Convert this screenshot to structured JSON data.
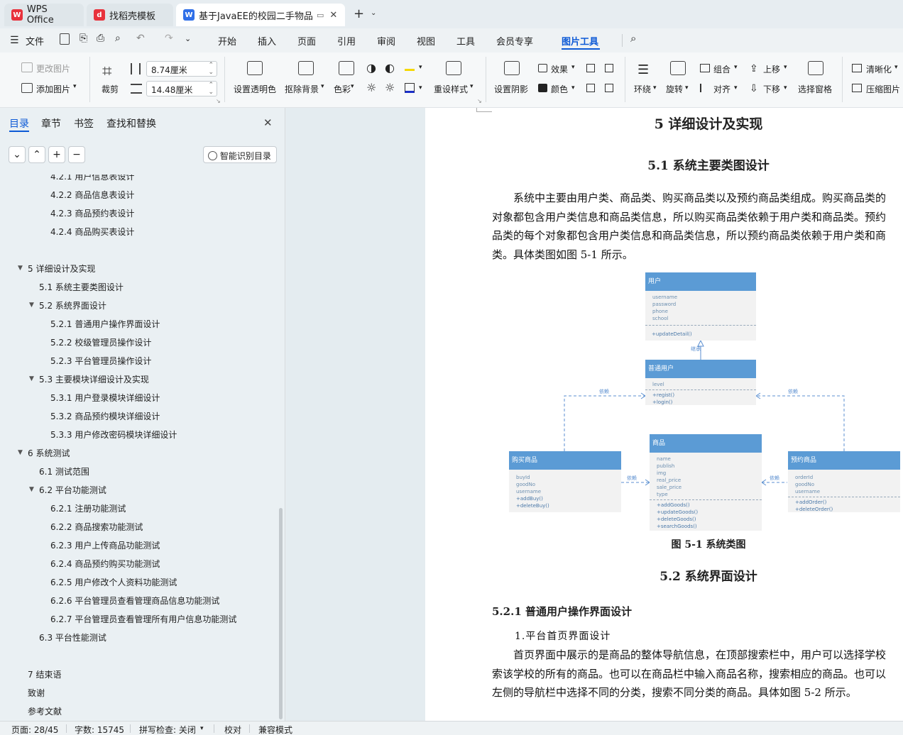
{
  "tabs": [
    {
      "label": "WPS Office"
    },
    {
      "label": "找稻壳模板"
    },
    {
      "label": "基于JavaEE的校园二手物品交"
    }
  ],
  "menu": {
    "file": "文件",
    "items": [
      "开始",
      "插入",
      "页面",
      "引用",
      "审阅",
      "视图",
      "工具",
      "会员专享",
      "图片工具"
    ]
  },
  "ribbon": {
    "change_pic": "更改图片",
    "add_pic": "添加图片",
    "crop": "裁剪",
    "width_value": "8.74厘米",
    "height_value": "14.48厘米",
    "transparent": "设置透明色",
    "remove_bg": "抠除背景",
    "color": "色彩",
    "reset_style": "重设样式",
    "shadow": "设置阴影",
    "effect": "效果",
    "fill_color": "颜色",
    "wrap": "环绕",
    "rotate": "旋转",
    "group": "组合",
    "align": "对齐",
    "up": "上移",
    "down": "下移",
    "select_pane": "选择窗格",
    "sharpen": "清晰化",
    "compress": "压缩图片"
  },
  "nav": {
    "tabs": [
      "目录",
      "章节",
      "书签",
      "查找和替换"
    ],
    "smart_btn": "智能识别目录",
    "items": [
      {
        "label": "4.2.1  用户信息表设计",
        "level": 3
      },
      {
        "label": "4.2.2  商品信息表设计",
        "level": 3
      },
      {
        "label": "4.2.3  商品预约表设计",
        "level": 3
      },
      {
        "label": "4.2.4  商品购买表设计",
        "level": 3
      },
      {
        "label": "5  详细设计及实现",
        "level": 1
      },
      {
        "label": "5.1  系统主要类图设计",
        "level": 2
      },
      {
        "label": "5.2  系统界面设计",
        "level": 2
      },
      {
        "label": "5.2.1  普通用户操作界面设计",
        "level": 3
      },
      {
        "label": "5.2.2  校级管理员操作设计",
        "level": 3
      },
      {
        "label": "5.2.3  平台管理员操作设计",
        "level": 3
      },
      {
        "label": "5.3  主要模块详细设计及实现",
        "level": 2
      },
      {
        "label": "5.3.1  用户登录模块详细设计",
        "level": 3
      },
      {
        "label": "5.3.2  商品预约模块详细设计",
        "level": 3
      },
      {
        "label": "5.3.3  用户修改密码模块详细设计",
        "level": 3
      },
      {
        "label": "6  系统测试",
        "level": 1
      },
      {
        "label": "6.1  测试范围",
        "level": 2
      },
      {
        "label": "6.2  平台功能测试",
        "level": 2
      },
      {
        "label": "6.2.1  注册功能测试",
        "level": 3
      },
      {
        "label": "6.2.2  商品搜索功能测试",
        "level": 3
      },
      {
        "label": "6.2.3  用户上传商品功能测试",
        "level": 3
      },
      {
        "label": "6.2.4  商品预约购买功能测试",
        "level": 3
      },
      {
        "label": "6.2.5  用户修改个人资料功能测试",
        "level": 3
      },
      {
        "label": "6.2.6  平台管理员查看管理商品信息功能测试",
        "level": 3
      },
      {
        "label": "6.2.7  平台管理员查看管理所有用户信息功能测试",
        "level": 3
      },
      {
        "label": "6.3  平台性能测试",
        "level": 2
      },
      {
        "label": "7  结束语",
        "level": 1
      },
      {
        "label": "致谢",
        "level": 1
      },
      {
        "label": "参考文献",
        "level": 1
      }
    ]
  },
  "doc": {
    "h1": "5  详细设计及实现",
    "h2a": "5.1  系统主要类图设计",
    "p1": [
      "系统中主要由用户类、商品类、购买商品类以及预约商品类组成。购买商品类的",
      "对象都包含用户类信息和商品类信息，所以购买商品类依赖于用户类和商品类。预约",
      "品类的每个对象都包含用户类信息和商品类信息，所以预约商品类依赖于用户类和商",
      "类。具体类图如图 5-1 所示。"
    ],
    "caption": "图 5-1  系统类图",
    "h2b": "5.2  系统界面设计",
    "h3": "5.2.1  普通用户操作界面设计",
    "sub": "1.平台首页界面设计",
    "p2": [
      "首页界面中展示的是商品的整体导航信息，在顶部搜索栏中，用户可以选择学校",
      "索该学校的所有的商品。也可以在商品栏中输入商品名称，搜索相应的商品。也可以",
      "左侧的导航栏中选择不同的分类，搜索不同分类的商品。具体如图 5-2 所示。"
    ]
  },
  "uml": {
    "user": {
      "name": "用户",
      "attrs": [
        "username",
        "password",
        "phone",
        "school"
      ],
      "methods": [
        "+updateDetail()"
      ]
    },
    "normal": {
      "name": "普通用户",
      "attrs": [
        "level"
      ],
      "methods": [
        "+regist()",
        "+login()"
      ]
    },
    "goods": {
      "name": "商品",
      "attrs": [
        "name",
        "publish",
        "img",
        "real_price",
        "sale_price",
        "type"
      ],
      "methods": [
        "+addGoods()",
        "+updateGoods()",
        "+deleteGoods()",
        "+searchGoods()"
      ]
    },
    "buy": {
      "name": "购买商品",
      "attrs": [
        "buyId",
        "goodNo",
        "username"
      ],
      "methods": [
        "+addBuy()",
        "+deleteBuy()"
      ]
    },
    "order": {
      "name": "预约商品",
      "attrs": [
        "orderId",
        "goodNo",
        "username"
      ],
      "methods": [
        "+addOrder()",
        "+deleteOrder()"
      ]
    },
    "dep": "依赖",
    "inherit": "继承"
  },
  "status": {
    "page": "页面: 28/45",
    "words": "字数: 15745",
    "spell": "拼写检查: 关闭",
    "proof": "校对",
    "compat": "兼容模式"
  }
}
